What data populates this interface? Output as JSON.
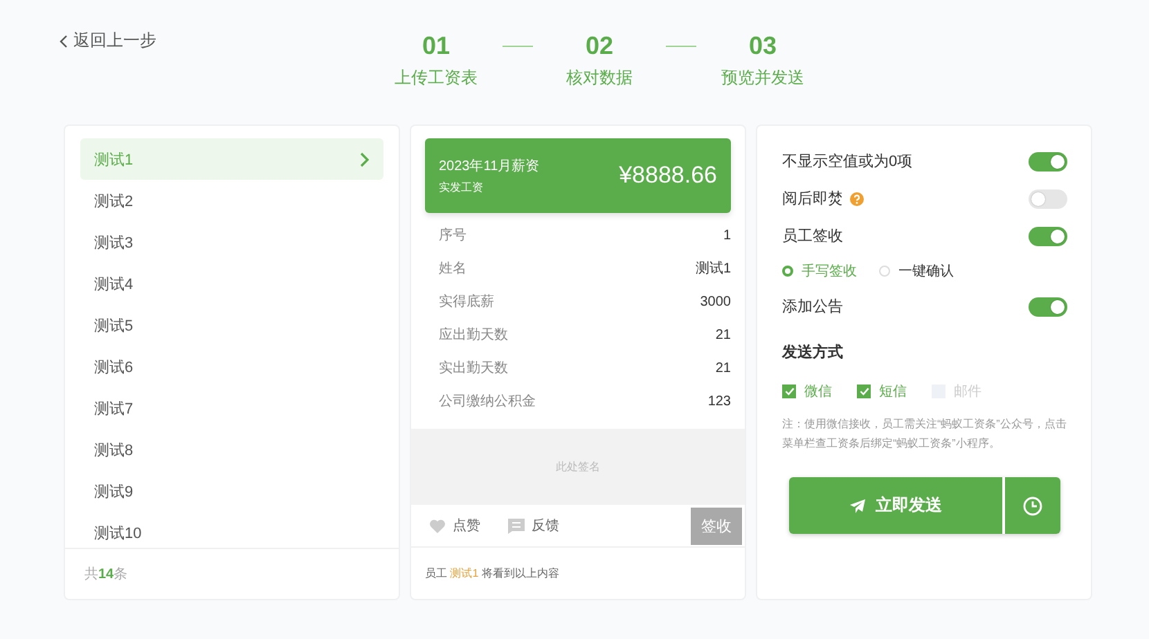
{
  "back_link": "返回上一步",
  "steps": [
    {
      "number": "01",
      "label": "上传工资表"
    },
    {
      "number": "02",
      "label": "核对数据"
    },
    {
      "number": "03",
      "label": "预览并发送"
    }
  ],
  "employee_list": {
    "items": [
      {
        "name": "测试1",
        "selected": true
      },
      {
        "name": "测试2",
        "selected": false
      },
      {
        "name": "测试3",
        "selected": false
      },
      {
        "name": "测试4",
        "selected": false
      },
      {
        "name": "测试5",
        "selected": false
      },
      {
        "name": "测试6",
        "selected": false
      },
      {
        "name": "测试7",
        "selected": false
      },
      {
        "name": "测试8",
        "selected": false
      },
      {
        "name": "测试9",
        "selected": false
      },
      {
        "name": "测试10",
        "selected": false
      }
    ],
    "total": {
      "prefix": "共",
      "count": "14",
      "suffix": "条"
    }
  },
  "payslip": {
    "period": "2023年11月薪资",
    "amount_label": "实发工资",
    "amount": "¥8888.66",
    "rows": [
      {
        "label": "序号",
        "value": "1"
      },
      {
        "label": "姓名",
        "value": "测试1"
      },
      {
        "label": "实得底薪",
        "value": "3000"
      },
      {
        "label": "应出勤天数",
        "value": "21"
      },
      {
        "label": "实出勤天数",
        "value": "21"
      },
      {
        "label": "公司缴纳公积金",
        "value": "123"
      }
    ],
    "signature_placeholder": "此处签名",
    "like": "点赞",
    "feedback": "反馈",
    "sign_button": {
      "label": "签收",
      "disabled": true
    },
    "footer": {
      "prefix": "员工",
      "name": "测试1",
      "suffix": "将看到以上内容"
    }
  },
  "settings": {
    "options": [
      {
        "kind": "toggle",
        "label": "不显示空值或为0项",
        "on": true
      },
      {
        "kind": "toggle",
        "label": "阅后即焚",
        "on": false,
        "help": true
      },
      {
        "kind": "toggle",
        "label": "员工签收",
        "on": true
      },
      {
        "kind": "radio",
        "choices": [
          {
            "label": "手写签收",
            "selected": true
          },
          {
            "label": "一键确认",
            "selected": false
          }
        ]
      },
      {
        "kind": "toggle",
        "label": "添加公告",
        "on": true
      }
    ],
    "send_method_title": "发送方式",
    "channels": [
      {
        "label": "微信",
        "checked": true
      },
      {
        "label": "短信",
        "checked": true
      },
      {
        "label": "邮件",
        "checked": false
      }
    ],
    "note": "注：使用微信接收，员工需关注“蚂蚁工资条”公众号，点击菜单栏查工资条后绑定“蚂蚁工资条”小程序。",
    "send_button": "立即发送"
  }
}
